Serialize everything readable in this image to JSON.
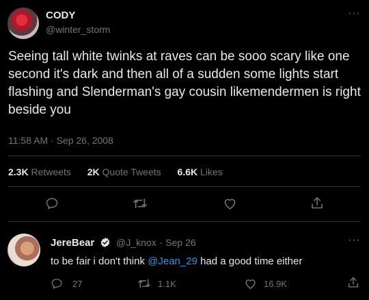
{
  "tweet": {
    "display_name": "CODY",
    "handle": "@winter_storm",
    "text": "Seeing tall white twinks at raves can be sooo scary like one second it's dark and then all of a sudden some lights start flashing and Slenderman's gay cousin likemendermen is right beside you",
    "time": "11:58 AM",
    "separator": "·",
    "date": "Sep 26, 2008",
    "more_label": "···",
    "stats": {
      "retweets_count": "2.3K",
      "retweets_label": "Retweets",
      "quotes_count": "2K",
      "quotes_label": "Quote Tweets",
      "likes_count": "6.6K",
      "likes_label": "Likes"
    }
  },
  "reply": {
    "display_name": "JereBear",
    "handle": "@J_knox",
    "separator": "·",
    "date": "Sep 26",
    "text_before": "to be fair i don't think ",
    "mention": "@Jean_29",
    "text_after": " had a good time either",
    "more_label": "···",
    "replies_count": "27",
    "retweets_count": "1.1K",
    "likes_count": "16.9K"
  },
  "icons": [
    "reply-icon",
    "retweet-icon",
    "like-icon",
    "share-icon",
    "verified-badge-icon"
  ],
  "colors": {
    "background": "#000000",
    "text": "#e7e9ea",
    "muted": "#71767b",
    "accent": "#1d9bf0",
    "divider": "#2f3336"
  }
}
